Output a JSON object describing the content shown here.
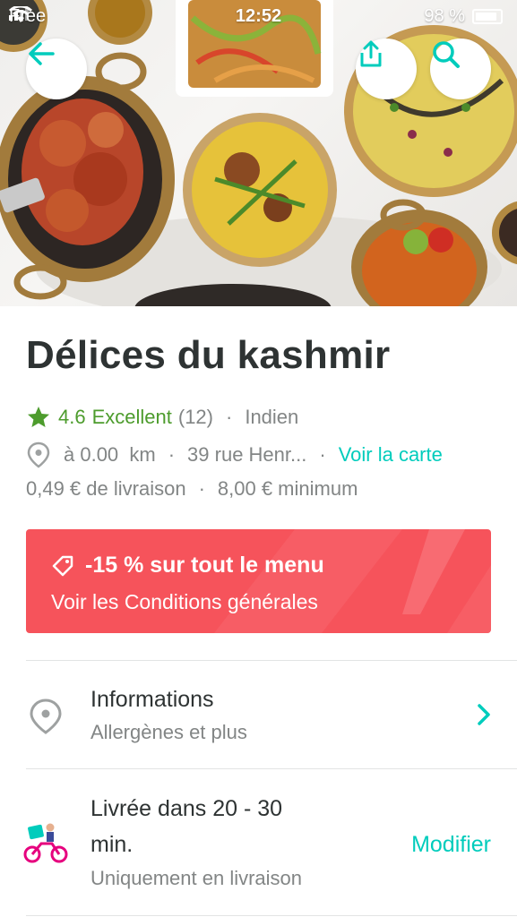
{
  "status_bar": {
    "carrier": "Free",
    "time": "12:52",
    "battery": "98 %"
  },
  "hero": {
    "image": "restaurant-dishes-photo"
  },
  "header_buttons": {
    "back_icon": "arrow-left-icon",
    "share_icon": "share-icon",
    "search_icon": "search-icon"
  },
  "restaurant": {
    "name": "Délices du kashmir",
    "rating_value": "4.6",
    "rating_label": "Excellent",
    "rating_count": "(12)",
    "cuisine": "Indien",
    "distance": "à 0.00  km",
    "address": "39 rue Henr...",
    "map_link": "Voir la carte",
    "delivery_fee": "0,49 € de livraison",
    "minimum": "8,00 € minimum",
    "separator": "·"
  },
  "offer": {
    "title": "-15 % sur tout le menu",
    "subtitle": "Voir les Conditions générales"
  },
  "info_row": {
    "title": "Informations",
    "subtitle": "Allergènes et plus"
  },
  "delivery_row": {
    "title_line1": "Livrée dans 20 - 30",
    "title_line2": "min.",
    "subtitle": "Uniquement en livraison",
    "action": "Modifier"
  },
  "colors": {
    "accent": "#00ccbc",
    "offer": "#f6535b",
    "rating": "#4d9c2d"
  }
}
